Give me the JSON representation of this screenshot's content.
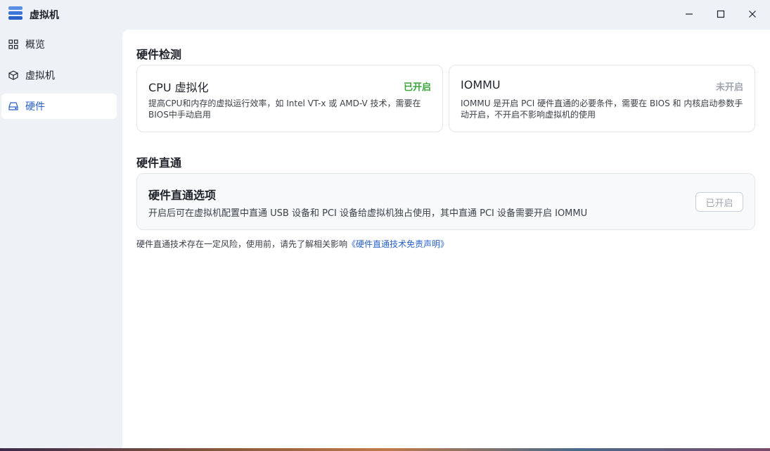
{
  "window": {
    "title": "虚拟机",
    "controls": {
      "minimize": "minimize-icon",
      "maximize": "maximize-icon",
      "close": "close-icon"
    }
  },
  "sidebar": {
    "items": [
      {
        "label": "概览",
        "icon": "grid-icon"
      },
      {
        "label": "虚拟机",
        "icon": "cube-icon"
      },
      {
        "label": "硬件",
        "icon": "drive-icon",
        "active": true
      }
    ]
  },
  "hardware_detection": {
    "title": "硬件检测",
    "cards": [
      {
        "title": "CPU 虚拟化",
        "status": "已开启",
        "status_color": "#3aa63a",
        "desc_line1": "提高CPU和内存的虚拟运行效率，如 Intel VT-x 或 AMD-V 技术，需要在",
        "desc_line2": "BIOS中手动启用"
      },
      {
        "title": "IOMMU",
        "status": "未开启",
        "status_color": "#a0a6ae",
        "desc_line1": "IOMMU 是开启 PCI 硬件直通的必要条件，需要在 BIOS 和 内核启动参数手",
        "desc_line2": "动开启，不开启不影响虚拟机的使用"
      }
    ]
  },
  "passthrough": {
    "section_title": "硬件直通",
    "option_title": "硬件直通选项",
    "option_desc": "开启后可在虚拟机配置中直通 USB 设备和 PCI 设备给虚拟机独占使用，其中直通 PCI 设备需要开启 IOMMU",
    "button_label": "已开启"
  },
  "disclaimer": {
    "text": "硬件直通技术存在一定风险，使用前，请先了解相关影响",
    "link": "《硬件直通技术免责声明》"
  },
  "colors": {
    "accent": "#2a62c8",
    "enabled": "#3aa63a",
    "disabled": "#a0a6ae"
  }
}
